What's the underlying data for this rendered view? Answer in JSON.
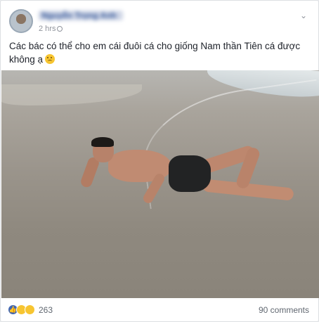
{
  "post": {
    "author_name": "Nguyễn Trọng Anh",
    "time": "2 hrs",
    "text": "Các bác có thể cho em cái đuôi cá cho giống Nam thần Tiên cá được không ạ",
    "text_emoji": "sad-face-icon"
  },
  "footer": {
    "reaction_icons": [
      "like-icon",
      "haha-icon",
      "sad-icon"
    ],
    "reaction_count": "263",
    "comments_label": "90 comments"
  },
  "colors": {
    "link_blue": "#365899",
    "meta_gray": "#90949c",
    "like_blue": "#4267b2",
    "emoji_yellow": "#f7c531"
  }
}
